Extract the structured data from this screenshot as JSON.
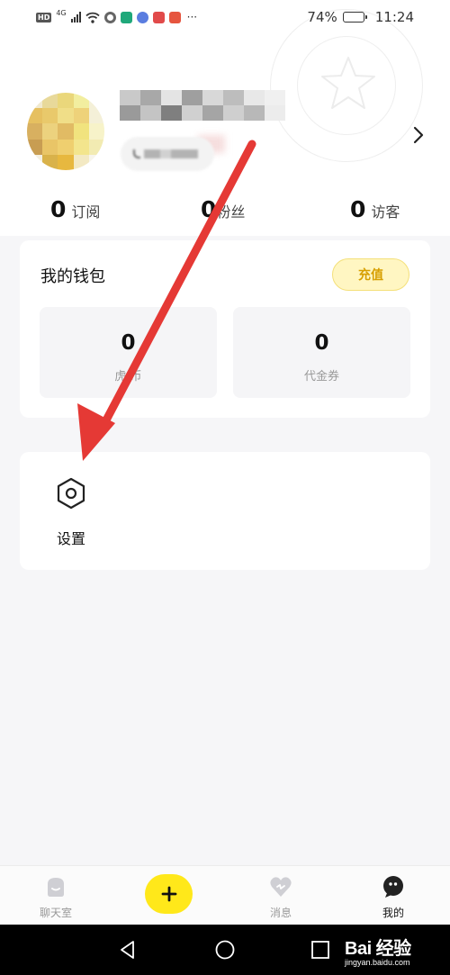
{
  "status_bar": {
    "hd_badge": "HD",
    "network_type": "4G",
    "more_icon": "···",
    "battery_percent": "74%",
    "battery_level": 0.74,
    "time": "11:24"
  },
  "stats": [
    {
      "value": "0",
      "label": "订阅"
    },
    {
      "value": "0",
      "label": "粉丝"
    },
    {
      "value": "0",
      "label": "访客"
    }
  ],
  "wallet": {
    "title": "我的钱包",
    "recharge_label": "充值",
    "items": [
      {
        "value": "0",
        "label": "虎  币"
      },
      {
        "value": "0",
        "label": "代金券"
      }
    ]
  },
  "settings": {
    "label": "设置",
    "icon": "settings-hexagon-icon"
  },
  "tab_bar": {
    "items": [
      {
        "label": "聊天室",
        "icon": "chatroom-icon"
      },
      {
        "label": "消息",
        "icon": "heart-message-icon"
      },
      {
        "label": "我的",
        "icon": "profile-bubble-icon"
      }
    ],
    "compose_icon": "plus-icon"
  },
  "watermark": {
    "logo": "Bai  经验",
    "url": "jingyan.baidu.com"
  },
  "colors": {
    "accent_yellow": "#ffe81a",
    "recharge_text": "#d79f00",
    "arrow_red": "#e53935",
    "page_bg": "#f6f6f8"
  }
}
